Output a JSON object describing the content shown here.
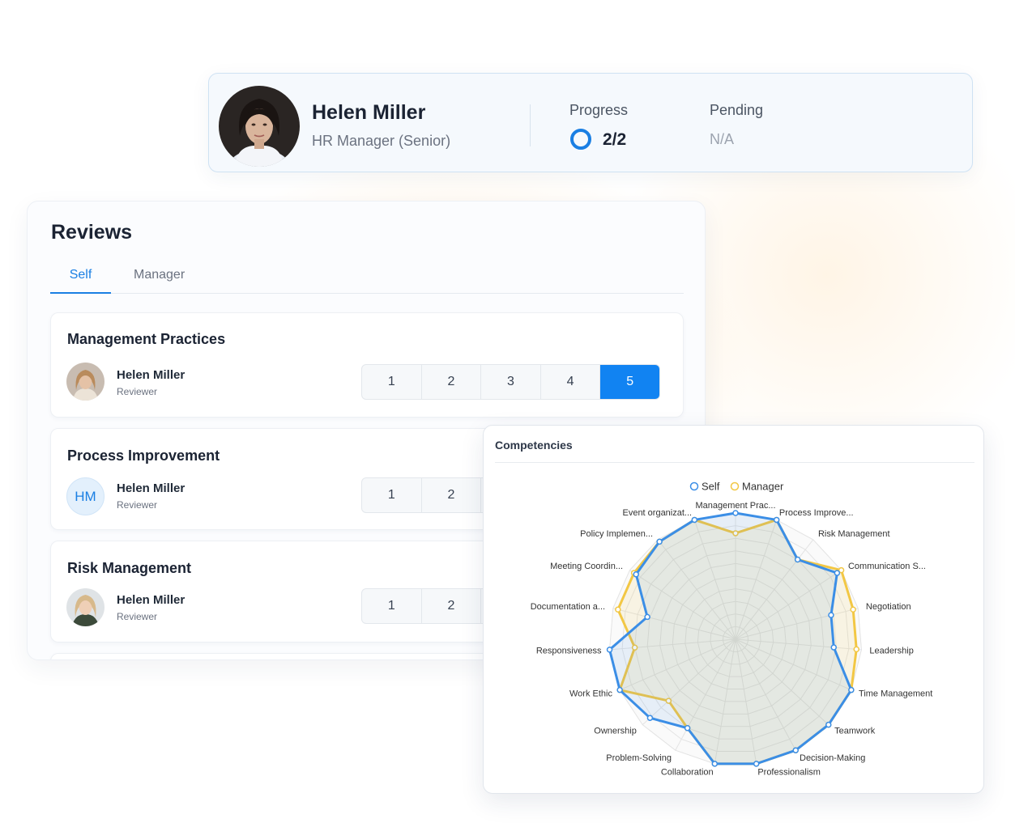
{
  "profile": {
    "name": "Helen Miller",
    "role": "HR Manager (Senior)",
    "progress_label": "Progress",
    "progress_value": "2/2",
    "pending_label": "Pending",
    "pending_value": "N/A"
  },
  "reviews": {
    "title": "Reviews",
    "tabs": [
      "Self",
      "Manager"
    ],
    "active_tab": "Self",
    "items": [
      {
        "title": "Management Practices",
        "reviewer": "Helen Miller",
        "reviewer_role": "Reviewer",
        "avatar": "photo",
        "ratings": [
          "1",
          "2",
          "3",
          "4",
          "5"
        ],
        "selected": "5"
      },
      {
        "title": "Process Improvement",
        "reviewer": "Helen Miller",
        "reviewer_role": "Reviewer",
        "avatar": "initials",
        "initials": "HM",
        "ratings": [
          "1",
          "2"
        ]
      },
      {
        "title": "Risk Management",
        "reviewer": "Helen Miller",
        "reviewer_role": "Reviewer",
        "avatar": "photo",
        "ratings": [
          "1",
          "2"
        ]
      }
    ]
  },
  "competencies": {
    "title": "Competencies"
  },
  "chart_data": {
    "type": "radar",
    "title": "Competencies",
    "legend": [
      "Self",
      "Manager"
    ],
    "legend_position": "top-center",
    "axes": [
      "Management Prac...",
      "Process Improve...",
      "Risk Management",
      "Communication S...",
      "Negotiation",
      "Leadership",
      "Time Management",
      "Teamwork",
      "Decision-Making",
      "Professionalism",
      "Collaboration",
      "Problem-Solving",
      "Ownership",
      "Work Ethic",
      "Responsiveness",
      "Documentation a...",
      "Meeting Coordin...",
      "Policy Implemen...",
      "Event organizat..."
    ],
    "max": 5,
    "series": [
      {
        "name": "Self",
        "color": "#3b8ee6",
        "values": [
          5,
          5,
          4,
          4.8,
          3.9,
          3.9,
          5,
          5,
          5,
          5,
          5,
          4,
          4.6,
          5,
          5,
          3.6,
          4.7,
          4.9,
          5
        ]
      },
      {
        "name": "Manager",
        "color": "#f2c744",
        "values": [
          4.2,
          5,
          4,
          5,
          4.8,
          4.8,
          5,
          5,
          5,
          5,
          5,
          4,
          3.6,
          5,
          4,
          4.8,
          4.8,
          4.9,
          5
        ]
      }
    ]
  }
}
